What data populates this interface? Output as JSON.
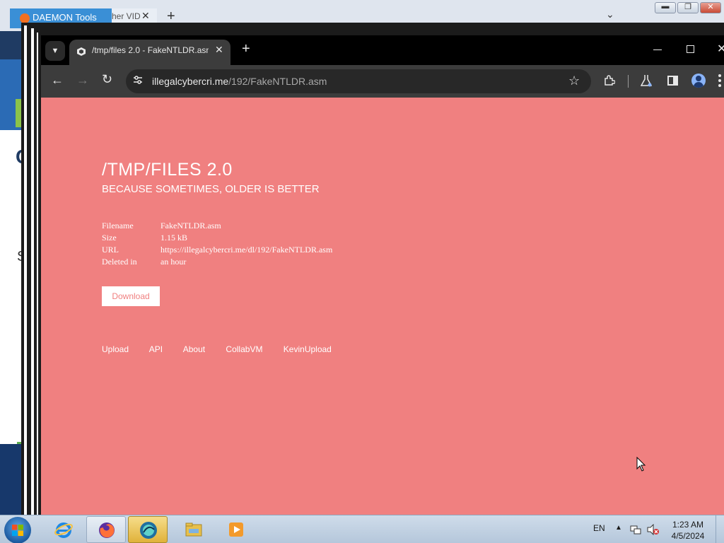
{
  "background_window": {
    "tab1_label": "DAEMON Tools",
    "tab2_label": "her VID",
    "left_glyph_c": "C",
    "left_glyph_s": "S",
    "colors": {
      "tab": "#3a8fd6",
      "strip": "#1f3b63"
    }
  },
  "browser": {
    "tab": {
      "title": "/tmp/files 2.0 - FakeNTLDR.asm",
      "favicon": "cube-icon"
    },
    "address": {
      "domain": "illegalcybercri.me",
      "path": "/192/FakeNTLDR.asm"
    }
  },
  "page": {
    "background_color": "#f08080",
    "title": "/TMP/FILES 2.0",
    "subtitle": "BECAUSE SOMETIMES, OLDER IS BETTER",
    "info": [
      {
        "key": "Filename",
        "value": "FakeNTLDR.asm"
      },
      {
        "key": "Size",
        "value": "1.15 kB"
      },
      {
        "key": "URL",
        "value": "https://illegalcybercri.me/dl/192/FakeNTLDR.asm"
      },
      {
        "key": "Deleted in",
        "value": "an hour"
      }
    ],
    "download_label": "Download",
    "footer_links": [
      "Upload",
      "API",
      "About",
      "CollabVM",
      "KevinUpload"
    ]
  },
  "taskbar": {
    "items": [
      "start-orb",
      "internet-explorer-icon",
      "firefox-icon",
      "daemon-tools-icon",
      "file-explorer-icon",
      "media-player-icon"
    ],
    "language": "EN",
    "time": "1:23 AM",
    "date": "4/5/2024"
  }
}
